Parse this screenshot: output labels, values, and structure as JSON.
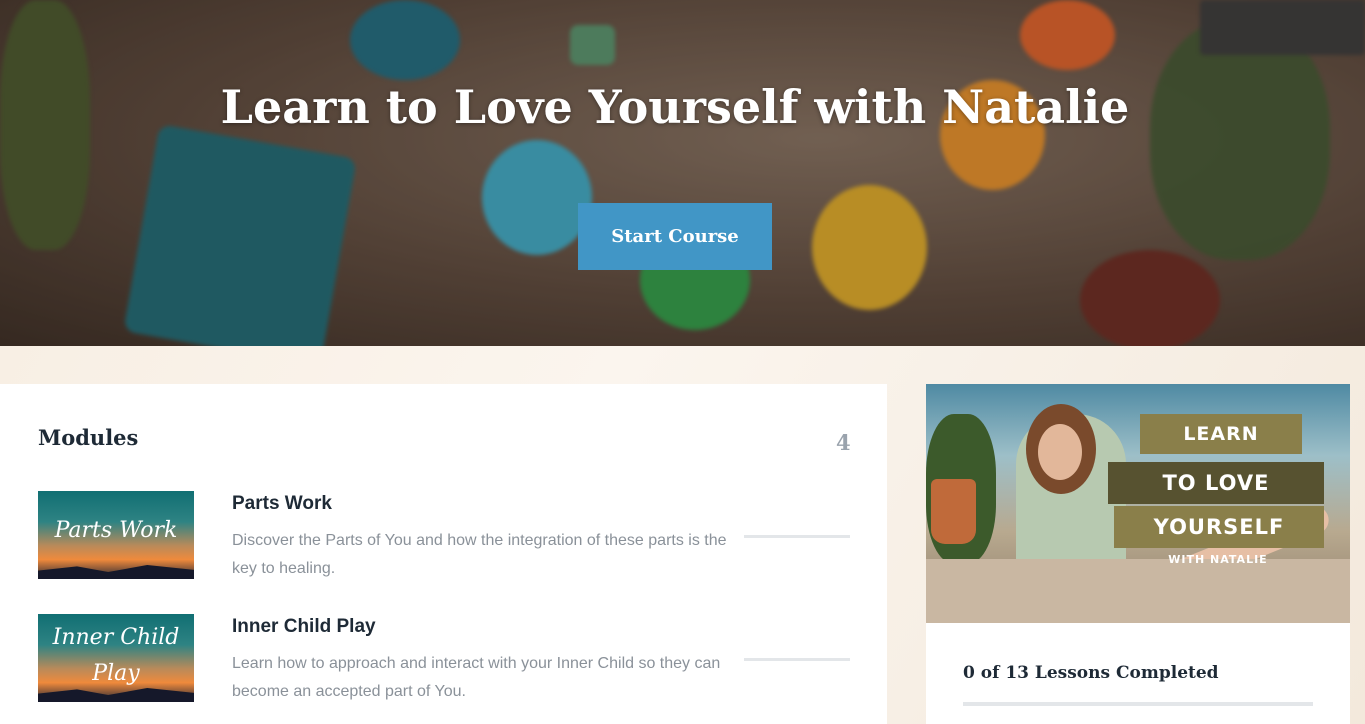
{
  "hero": {
    "title": "Learn to Love Yourself with Natalie",
    "start_label": "Start Course"
  },
  "modules": {
    "heading": "Modules",
    "count": "4",
    "items": [
      {
        "name": "Parts Work",
        "thumb_text": "Parts Work",
        "description": "Discover the Parts of You and how the integration of these parts is the key to healing.",
        "progress": 0
      },
      {
        "name": "Inner Child Play",
        "thumb_text_line1": "Inner Child",
        "thumb_text_line2": "Play",
        "description": "Learn how to approach and interact with your Inner Child so they can become an accepted part of You.",
        "progress": 0
      }
    ]
  },
  "sidebar": {
    "image_tags": {
      "line1": "LEARN",
      "line2": "TO LOVE",
      "line3": "YOURSELF",
      "line4": "WITH NATALIE"
    },
    "lessons_completed": "0 of 13 Lessons Completed",
    "lessons_done": 0,
    "lessons_total": 13
  },
  "colors": {
    "accent": "#4196c6",
    "heading": "#1e2a36",
    "muted": "#8a9199",
    "tag_olive": "#8a7f4a",
    "tag_dark": "#575230"
  }
}
